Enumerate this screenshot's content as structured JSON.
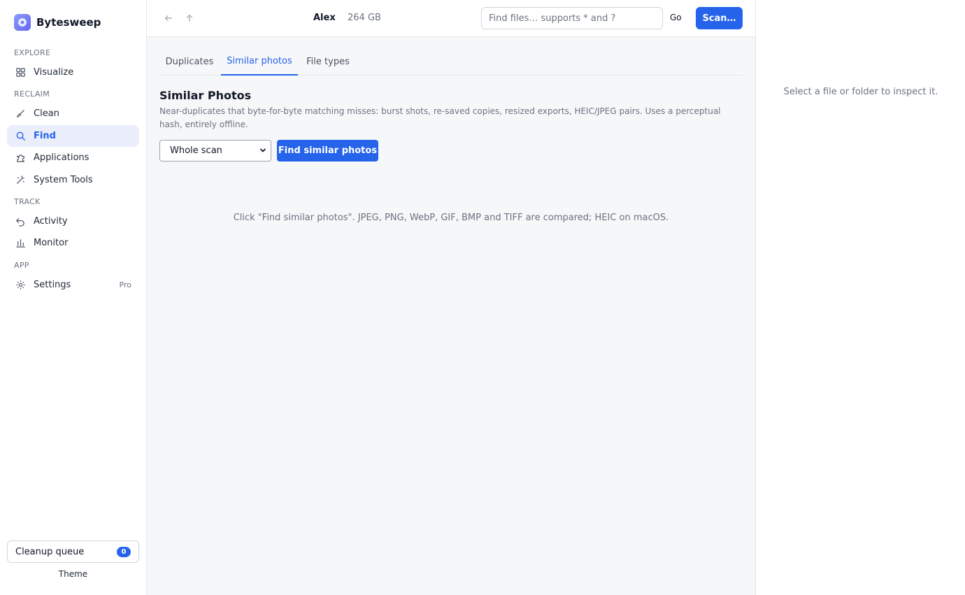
{
  "app": {
    "name": "Bytesweep"
  },
  "sidebar": {
    "sections": {
      "explore": "EXPLORE",
      "reclaim": "RECLAIM",
      "track": "TRACK",
      "app": "APP"
    },
    "items": [
      {
        "label": "Visualize",
        "icon": "grid-icon"
      },
      {
        "label": "Clean",
        "icon": "broom-icon"
      },
      {
        "label": "Find",
        "icon": "search-icon",
        "active": true
      },
      {
        "label": "Applications",
        "icon": "puzzle-icon"
      },
      {
        "label": "System Tools",
        "icon": "wand-icon"
      },
      {
        "label": "Activity",
        "icon": "undo-icon"
      },
      {
        "label": "Monitor",
        "icon": "bar-chart-icon"
      },
      {
        "label": "Settings",
        "icon": "gear-icon",
        "badge": "Pro"
      }
    ],
    "queue": {
      "label": "Cleanup queue",
      "count": "0"
    },
    "theme_label": "Theme"
  },
  "topbar": {
    "location_name": "Alex",
    "location_size": "264 GB",
    "search_placeholder": "Find files… supports * and ?",
    "go_label": "Go",
    "scan_label": "Scan…"
  },
  "tabs": [
    {
      "label": "Duplicates",
      "active": false
    },
    {
      "label": "Similar photos",
      "active": true
    },
    {
      "label": "File types",
      "active": false
    }
  ],
  "panel": {
    "title": "Similar Photos",
    "description": "Near-duplicates that byte-for-byte matching misses: burst shots, re-saved copies, resized exports, HEIC/JPEG pairs. Uses a perceptual hash, entirely offline.",
    "scope_value": "Whole scan",
    "action_label": "Find similar photos",
    "empty_hint": "Click \"Find similar photos\". JPEG, PNG, WebP, GIF, BMP and TIFF are compared; HEIC on macOS."
  },
  "inspector": {
    "hint": "Select a file or folder to inspect it."
  },
  "colors": {
    "accent": "#2563eb",
    "active_bg": "#eaeefb"
  }
}
